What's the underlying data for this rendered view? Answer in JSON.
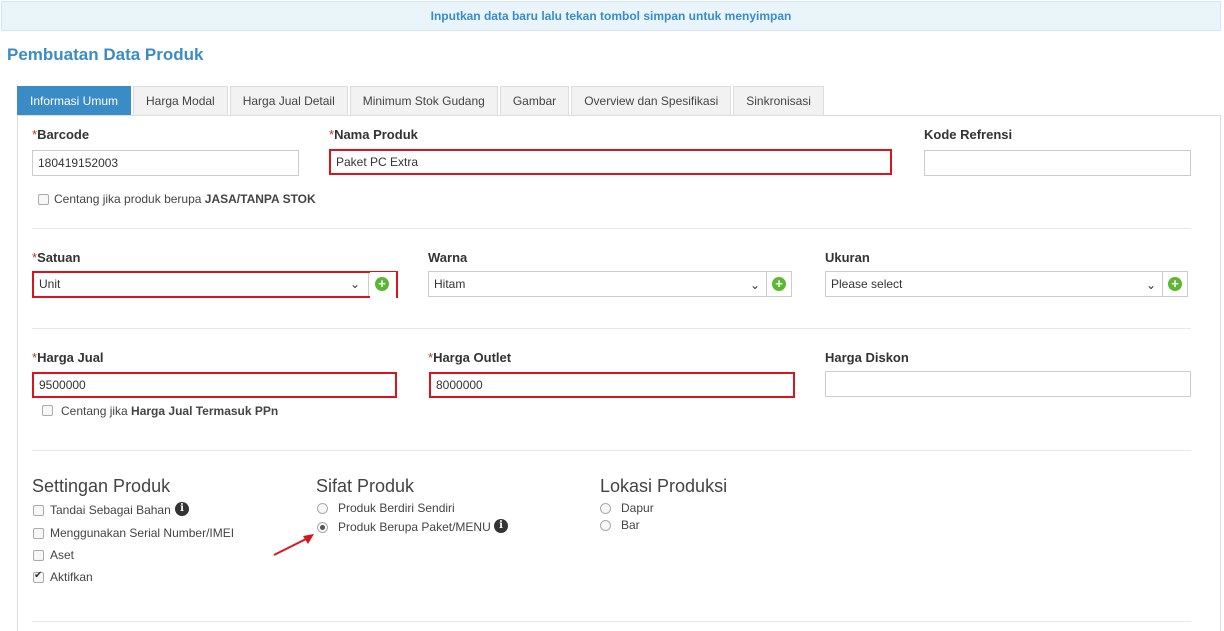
{
  "notice": "Inputkan data baru lalu tekan tombol simpan untuk menyimpan",
  "page_title": "Pembuatan Data Produk",
  "tabs": [
    "Informasi Umum",
    "Harga Modal",
    "Harga Jual Detail",
    "Minimum Stok Gudang",
    "Gambar",
    "Overview dan Spesifikasi",
    "Sinkronisasi"
  ],
  "required_mark": "*",
  "fields": {
    "barcode": {
      "label": "Barcode",
      "value": "180419152003"
    },
    "nama_produk": {
      "label": "Nama Produk",
      "value": "Paket PC Extra"
    },
    "kode_refrensi": {
      "label": "Kode Refrensi",
      "value": ""
    },
    "satuan": {
      "label": "Satuan",
      "value": "Unit"
    },
    "warna": {
      "label": "Warna",
      "value": "Hitam"
    },
    "ukuran": {
      "label": "Ukuran",
      "value": "Please select"
    },
    "harga_jual": {
      "label": "Harga Jual",
      "value": "9500000"
    },
    "harga_outlet": {
      "label": "Harga Outlet",
      "value": "8000000"
    },
    "harga_diskon": {
      "label": "Harga Diskon",
      "value": ""
    }
  },
  "checks": {
    "jasa_prefix": "Centang jika produk berupa ",
    "jasa_bold": "JASA/TANPA STOK",
    "ppn_prefix": "Centang jika ",
    "ppn_bold": "Harga Jual Termasuk PPn"
  },
  "settingan": {
    "title": "Settingan Produk",
    "items": [
      "Tandai Sebagai Bahan",
      "Menggunakan Serial Number/IMEI",
      "Aset",
      "Aktifkan"
    ]
  },
  "sifat": {
    "title": "Sifat Produk",
    "options": [
      "Produk Berdiri Sendiri",
      "Produk Berupa Paket/MENU"
    ]
  },
  "lokasi": {
    "title": "Lokasi Produksi",
    "options": [
      "Dapur",
      "Bar"
    ]
  },
  "icons": {
    "add": "plus-circle-icon",
    "info": "info-icon",
    "chevron": "chevron-down-icon"
  },
  "colors": {
    "accent": "#3a8cc6",
    "highlight": "#d9141c",
    "add": "#5cb833",
    "arrow": "#d9141c"
  }
}
